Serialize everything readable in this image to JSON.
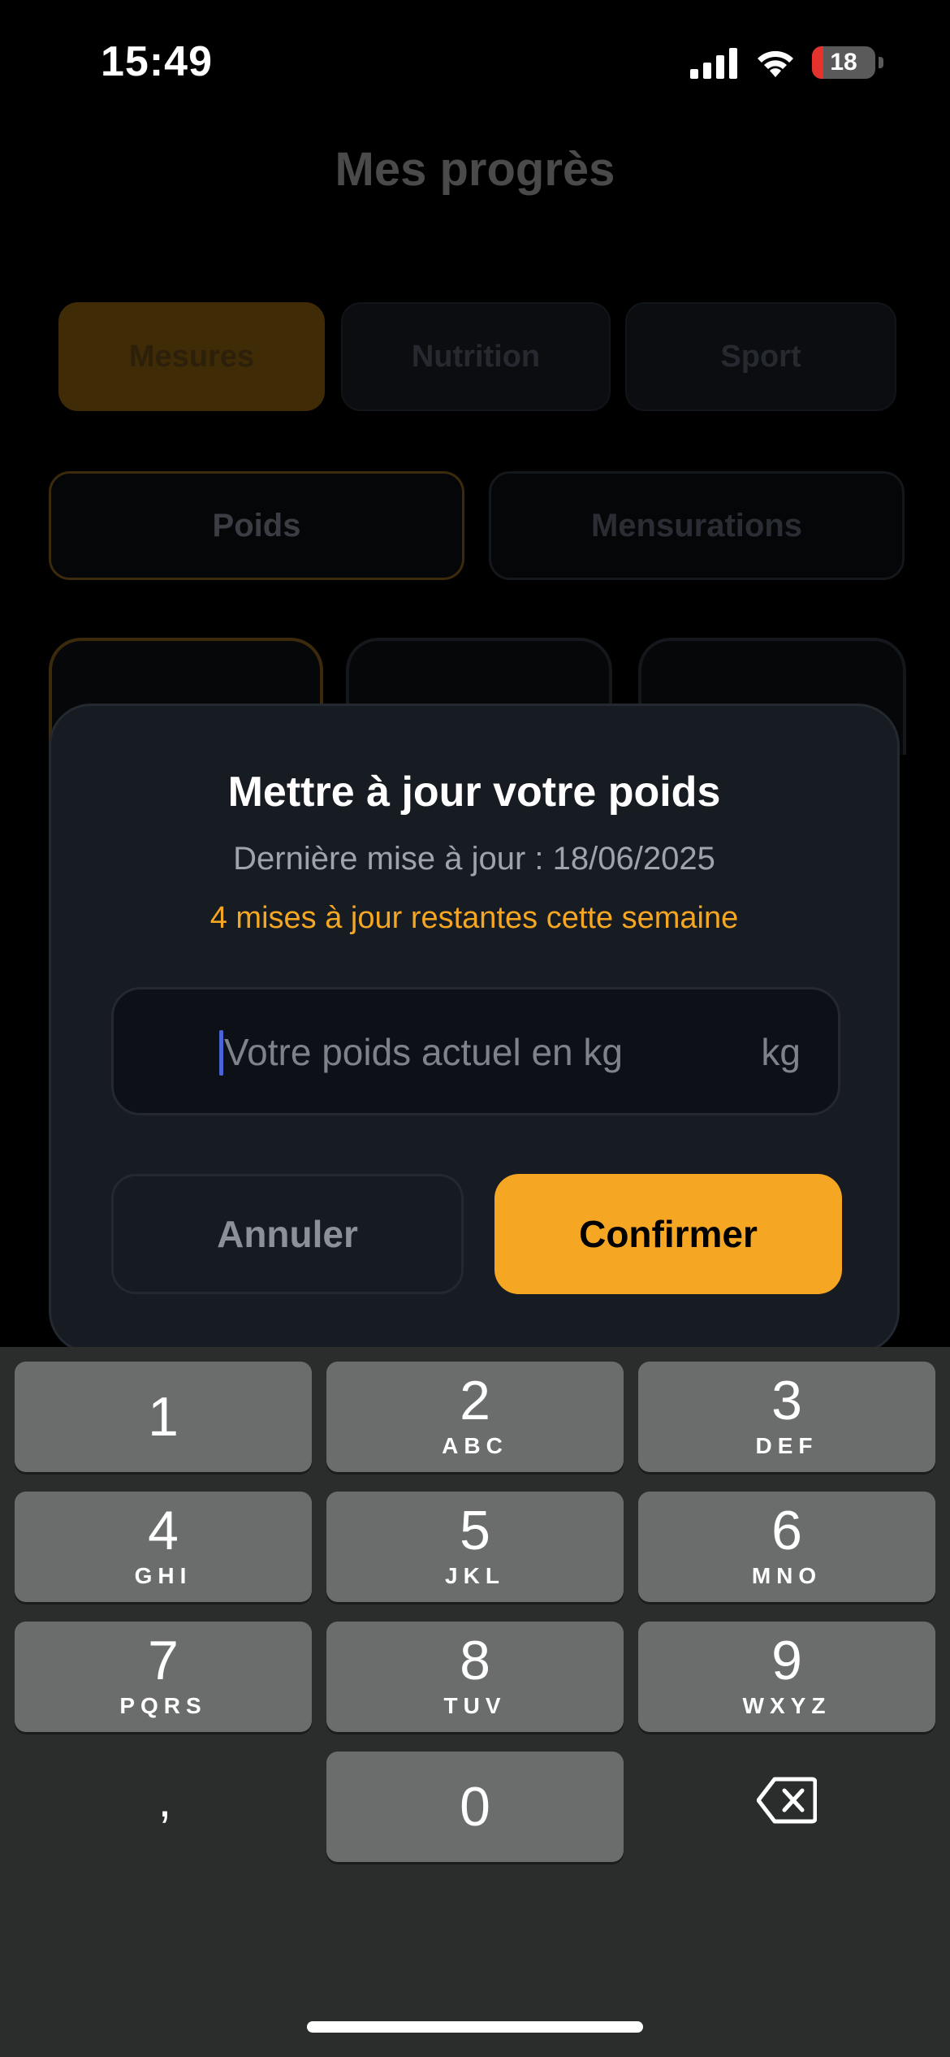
{
  "status_bar": {
    "time": "15:49",
    "battery_level": "18",
    "battery_fraction": 0.18,
    "icons": [
      "signal-icon",
      "wifi-icon",
      "battery-icon"
    ]
  },
  "background_page": {
    "title": "Mes progrès",
    "tabs": [
      {
        "label": "Mesures",
        "active": true
      },
      {
        "label": "Nutrition",
        "active": false
      },
      {
        "label": "Sport",
        "active": false
      }
    ],
    "subtabs": [
      {
        "label": "Poids",
        "active": true
      },
      {
        "label": "Mensurations",
        "active": false
      }
    ]
  },
  "modal": {
    "title": "Mettre à jour votre poids",
    "last_update": "Dernière mise à jour : 18/06/2025",
    "remaining": "4 mises à jour restantes cette semaine",
    "input": {
      "placeholder": "Votre poids actuel en kg",
      "value": "",
      "unit": "kg"
    },
    "cancel_label": "Annuler",
    "confirm_label": "Confirmer"
  },
  "keyboard": {
    "keys": [
      {
        "digit": "1",
        "letters": ""
      },
      {
        "digit": "2",
        "letters": "ABC"
      },
      {
        "digit": "3",
        "letters": "DEF"
      },
      {
        "digit": "4",
        "letters": "GHI"
      },
      {
        "digit": "5",
        "letters": "JKL"
      },
      {
        "digit": "6",
        "letters": "MNO"
      },
      {
        "digit": "7",
        "letters": "PQRS"
      },
      {
        "digit": "8",
        "letters": "TUV"
      },
      {
        "digit": "9",
        "letters": "WXYZ"
      },
      {
        "digit": "0",
        "letters": ""
      }
    ],
    "comma": ",",
    "backspace_icon": "backspace-icon"
  },
  "colors": {
    "accent": "#f5a623",
    "modal_bg": "#171b22",
    "keyboard_bg": "#2b2c2c",
    "key_bg": "#6b6c6c"
  }
}
